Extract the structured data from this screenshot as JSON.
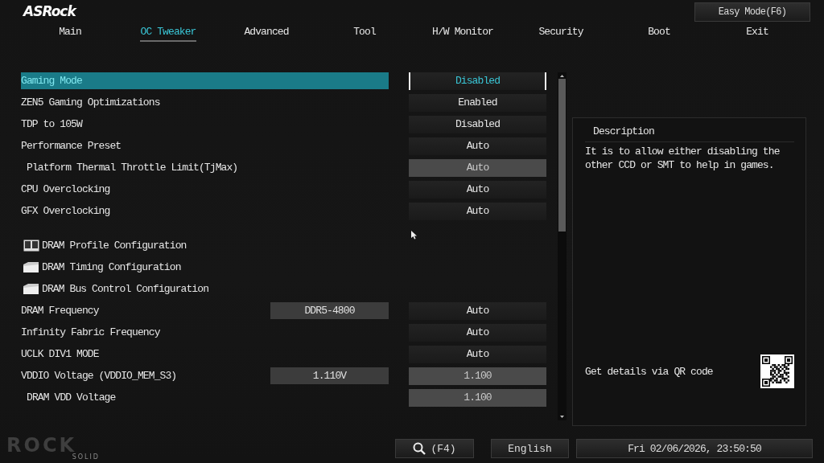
{
  "brand": {
    "logo": "ASRock",
    "easy_mode_button": "Easy Mode(F6)"
  },
  "tabs": [
    {
      "label": "Main",
      "selected": false
    },
    {
      "label": "OC Tweaker",
      "selected": true
    },
    {
      "label": "Advanced",
      "selected": false
    },
    {
      "label": "Tool",
      "selected": false
    },
    {
      "label": "H/W Monitor",
      "selected": false
    },
    {
      "label": "Security",
      "selected": false
    },
    {
      "label": "Boot",
      "selected": false
    },
    {
      "label": "Exit",
      "selected": false
    }
  ],
  "rows": [
    {
      "kind": "setting",
      "label": "Gaming Mode",
      "value": "Disabled",
      "selected": true,
      "disabled": false,
      "sub": false
    },
    {
      "kind": "setting",
      "label": "ZEN5 Gaming Optimizations",
      "value": "Enabled",
      "selected": false,
      "disabled": false,
      "sub": false
    },
    {
      "kind": "setting",
      "label": "TDP to 105W",
      "value": "Disabled",
      "selected": false,
      "disabled": false,
      "sub": false
    },
    {
      "kind": "setting",
      "label": "Performance Preset",
      "value": "Auto",
      "selected": false,
      "disabled": false,
      "sub": false
    },
    {
      "kind": "setting",
      "label": "Platform Thermal Throttle Limit(TjMax)",
      "value": "Auto",
      "selected": false,
      "disabled": true,
      "sub": true
    },
    {
      "kind": "setting",
      "label": "CPU Overclocking",
      "value": "Auto",
      "selected": false,
      "disabled": false,
      "sub": false
    },
    {
      "kind": "setting",
      "label": "GFX Overclocking",
      "value": "Auto",
      "selected": false,
      "disabled": false,
      "sub": false
    },
    {
      "kind": "spacer"
    },
    {
      "kind": "submenu",
      "label": "DRAM Profile Configuration"
    },
    {
      "kind": "submenu",
      "label": "DRAM Timing Configuration"
    },
    {
      "kind": "submenu",
      "label": "DRAM Bus Control Configuration"
    },
    {
      "kind": "setting",
      "label": "DRAM Frequency",
      "info": "DDR5-4800",
      "value": "Auto",
      "selected": false,
      "disabled": false,
      "sub": false
    },
    {
      "kind": "setting",
      "label": "Infinity Fabric Frequency",
      "value": "Auto",
      "selected": false,
      "disabled": false,
      "sub": false
    },
    {
      "kind": "setting",
      "label": "UCLK DIV1 MODE",
      "value": "Auto",
      "selected": false,
      "disabled": false,
      "sub": false
    },
    {
      "kind": "setting",
      "label": "VDDIO Voltage (VDDIO_MEM_S3)",
      "info": "1.110V",
      "value": "1.100",
      "selected": false,
      "disabled": true,
      "sub": false
    },
    {
      "kind": "setting",
      "label": "DRAM VDD Voltage",
      "value": "1.100",
      "selected": false,
      "disabled": true,
      "sub": true
    }
  ],
  "description": {
    "title": "Description",
    "text": "It is to allow either disabling the other CCD or SMT to help in games.",
    "qr_label": "Get details via QR code"
  },
  "footer": {
    "logo": "ROCK",
    "logo_sub": "SOLID",
    "search_key": "(F4)",
    "language": "English",
    "datetime": "Fri 02/06/2026, 23:50:50"
  }
}
